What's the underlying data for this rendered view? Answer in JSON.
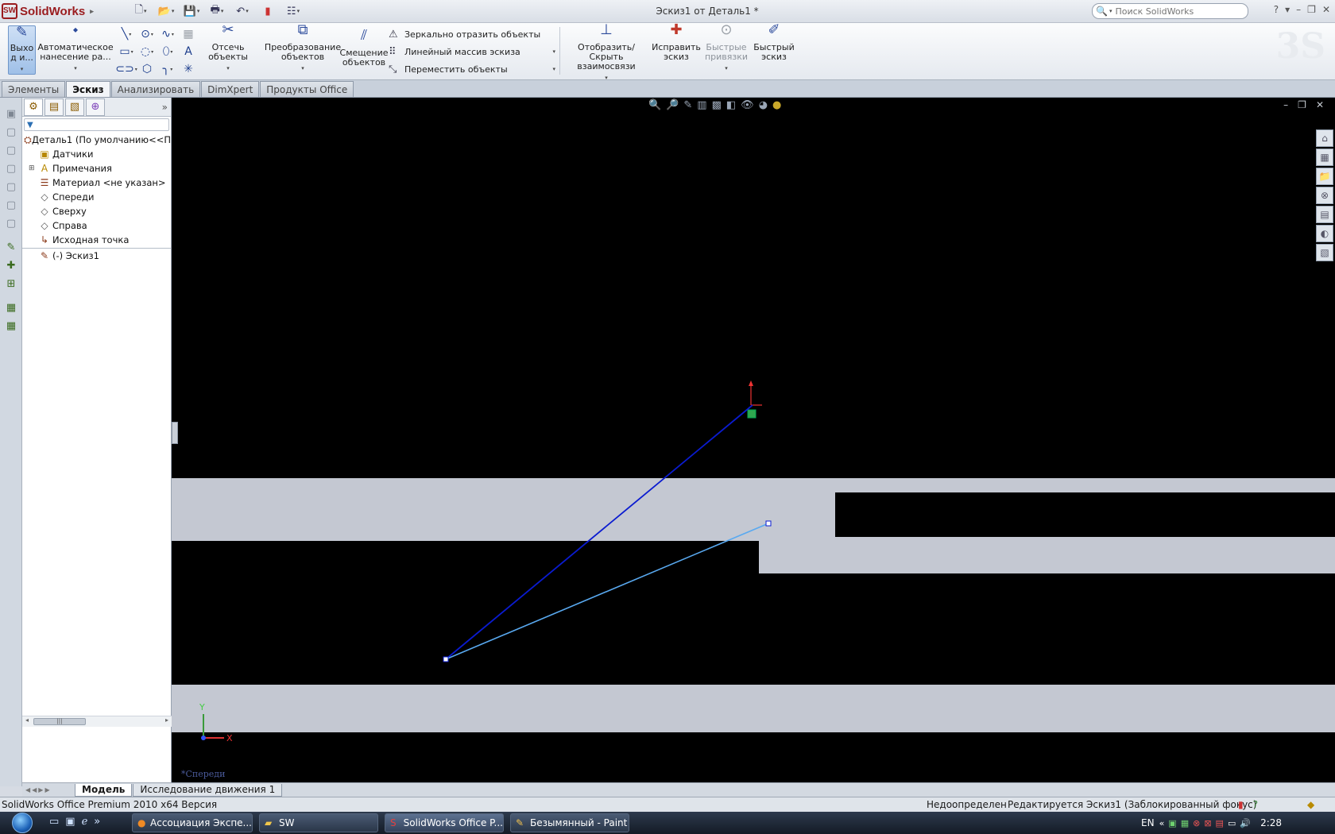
{
  "app": {
    "name": "SolidWorks",
    "window_title": "Эскиз1 от Деталь1 *",
    "search_placeholder": "Поиск SolidWorks"
  },
  "ribbon": {
    "exit_sketch": "Выхо\nд и...",
    "auto_dimension": "Автоматическое\nнанесение ра...",
    "trim": "Отсечь\nобъекты",
    "convert": "Преобразование\nобъектов",
    "offset": "Смещение\nобъектов",
    "mirror": "Зеркально отразить объекты",
    "linear_pattern": "Линейный массив эскиза",
    "move": "Переместить объекты",
    "show_hide_relations": "Отобразить/Скрыть\nвзаимосвязи",
    "repair_sketch": "Исправить\nэскиз",
    "quick_snaps": "Быстрые\nпривязки",
    "rapid_sketch": "Быстрый\nэскиз"
  },
  "tabs": [
    {
      "label": "Элементы",
      "active": false
    },
    {
      "label": "Эскиз",
      "active": true
    },
    {
      "label": "Анализировать",
      "active": false
    },
    {
      "label": "DimXpert",
      "active": false
    },
    {
      "label": "Продукты Office",
      "active": false
    }
  ],
  "tree": {
    "root": "Деталь1  (По умолчанию<<П",
    "sensors": "Датчики",
    "annotations": "Примечания",
    "material": "Материал <не указан>",
    "front": "Спереди",
    "top": "Сверху",
    "right": "Справа",
    "origin": "Исходная точка",
    "sketch": "(-) Эскиз1"
  },
  "viewport": {
    "view_name": "*Спереди",
    "axis_x": "X",
    "axis_y": "Y"
  },
  "bottom_tabs": [
    {
      "label": "Модель",
      "active": true
    },
    {
      "label": "Исследование движения 1",
      "active": false
    }
  ],
  "status": {
    "version": "SolidWorks Office Premium 2010 x64 Версия",
    "state": "Недоопределен",
    "editing": "Редактируется Эскиз1 (Заблокированный фокус)"
  },
  "taskbar": {
    "items": [
      {
        "label": "Ассоциация Экспе...",
        "icon": "firefox-icon"
      },
      {
        "label": "SW",
        "icon": "folder-icon"
      },
      {
        "label": "SolidWorks Office P...",
        "icon": "solidworks-icon"
      },
      {
        "label": "Безымянный - Paint",
        "icon": "paint-icon"
      }
    ],
    "lang": "EN",
    "clock": "2:28"
  },
  "colors": {
    "selected_line": "#0a1bd0",
    "preview_line": "#59a9f0",
    "background": "#000000",
    "band": "#c4c8d2"
  }
}
